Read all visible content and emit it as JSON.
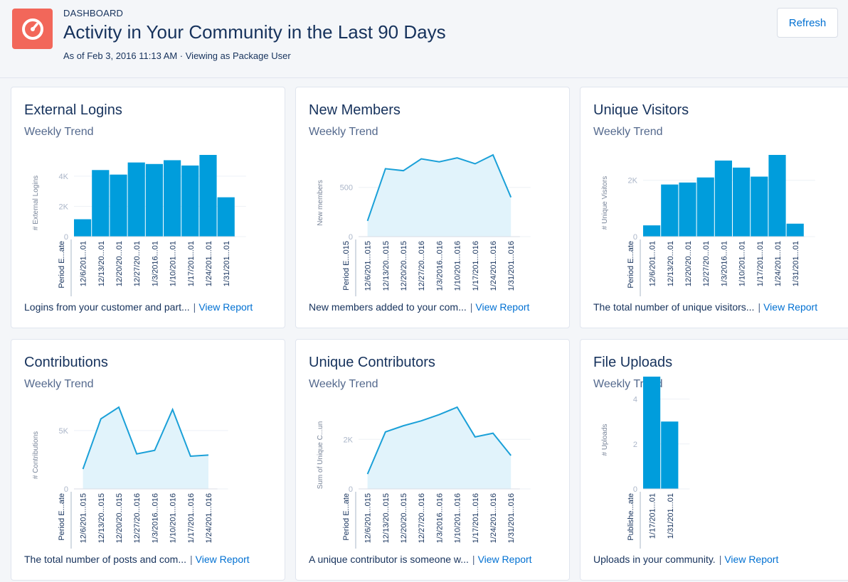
{
  "header": {
    "eyebrow": "DASHBOARD",
    "title": "Activity in Your Community in the Last 90 Days",
    "subtitle": "As of Feb 3, 2016 11:13 AM · Viewing as Package User",
    "refresh_label": "Refresh",
    "logo_icon": "dashboard-gauge-icon",
    "logo_color": "#f2675a"
  },
  "colors": {
    "bar": "#009ddc",
    "line": "#1aa0d8",
    "area": "#e1f3fb",
    "link": "#0070d2"
  },
  "view_report_label": "View Report",
  "cards": [
    {
      "title": "External Logins",
      "subtitle": "Weekly Trend",
      "footer": "Logins from your customer and part...",
      "footer_sep": "|"
    },
    {
      "title": "New Members",
      "subtitle": "Weekly Trend",
      "footer": "New members added to your com...",
      "footer_sep": "|"
    },
    {
      "title": "Unique Visitors",
      "subtitle": "Weekly Trend",
      "footer": "The total number of unique visitors...",
      "footer_sep": "|"
    },
    {
      "title": "Contributions",
      "subtitle": "Weekly Trend",
      "footer": "The total number of posts and com...",
      "footer_sep": "|"
    },
    {
      "title": "Unique Contributors",
      "subtitle": "Weekly Trend",
      "footer": "A unique contributor is someone w...",
      "footer_sep": "|"
    },
    {
      "title": "File Uploads",
      "subtitle": "Weekly Trend",
      "footer": "Uploads in your community.",
      "footer_sep": "|"
    }
  ],
  "chart_data": [
    {
      "type": "bar",
      "ylabel": "# External Logins",
      "xlabel": "Period E...ate",
      "categories": [
        "12/6/201...01",
        "12/13/20...01",
        "12/20/20...01",
        "12/27/20...01",
        "1/3/2016...01",
        "1/10/201...01",
        "1/17/201...01",
        "1/24/201...01",
        "1/31/201...01"
      ],
      "values": [
        1150,
        4400,
        4100,
        4900,
        4800,
        5050,
        4700,
        5400,
        2600
      ],
      "yticks": [
        0,
        2000,
        4000
      ],
      "ytick_labels": [
        "0",
        "2K",
        "4K"
      ],
      "ylim": [
        0,
        5400
      ]
    },
    {
      "type": "area",
      "ylabel": "New members",
      "xlabel": "Period E...015",
      "categories": [
        "12/6/201...015",
        "12/13/20...015",
        "12/20/20...015",
        "12/27/20...016",
        "1/3/2016...016",
        "1/10/201...016",
        "1/17/201...016",
        "1/24/201...016",
        "1/31/201...016"
      ],
      "values": [
        160,
        690,
        670,
        790,
        760,
        800,
        740,
        830,
        400
      ],
      "yticks": [
        0,
        500
      ],
      "ytick_labels": [
        "0",
        "500"
      ],
      "ylim": [
        0,
        830
      ]
    },
    {
      "type": "bar",
      "ylabel": "# Unique Visitors",
      "xlabel": "Period E...ate",
      "categories": [
        "12/6/201...01",
        "12/13/20...01",
        "12/20/20...01",
        "12/27/20...01",
        "1/3/2016...01",
        "1/10/201...01",
        "1/17/201...01",
        "1/24/201...01",
        "1/31/201...01"
      ],
      "values": [
        400,
        1850,
        1920,
        2100,
        2700,
        2450,
        2130,
        2900,
        460
      ],
      "yticks": [
        0,
        2000
      ],
      "ytick_labels": [
        "0",
        "2K"
      ],
      "ylim": [
        0,
        2900
      ]
    },
    {
      "type": "area",
      "ylabel": "# Contributions",
      "xlabel": "Period E...ate",
      "categories": [
        "12/6/201...015",
        "12/13/20...015",
        "12/20/20...015",
        "12/27/20...016",
        "1/3/2016...016",
        "1/10/201...016",
        "1/17/201...016",
        "1/24/201...016"
      ],
      "values": [
        1700,
        6000,
        7000,
        3000,
        3300,
        6800,
        2800,
        2900
      ],
      "yticks": [
        0,
        5000
      ],
      "ytick_labels": [
        "0",
        "5K"
      ],
      "ylim": [
        0,
        7000
      ]
    },
    {
      "type": "area",
      "ylabel": "Sum of Unique C...un",
      "xlabel": "Period E...ate",
      "categories": [
        "12/6/201...015",
        "12/13/20...015",
        "12/20/20...015",
        "12/27/20...016",
        "1/3/2016...016",
        "1/10/201...016",
        "1/17/201...016",
        "1/24/201...016",
        "1/31/201...016"
      ],
      "values": [
        600,
        2300,
        2550,
        2750,
        3000,
        3300,
        2100,
        2250,
        1350
      ],
      "yticks": [
        0,
        2000
      ],
      "ytick_labels": [
        "0",
        "2K"
      ],
      "ylim": [
        0,
        3300
      ]
    },
    {
      "type": "bar",
      "ylabel": "# Uploads",
      "xlabel": "Publishe...ate",
      "categories": [
        "1/17/201...01",
        "1/31/201...01"
      ],
      "values": [
        5,
        3
      ],
      "yticks": [
        0,
        2,
        4
      ],
      "ytick_labels": [
        "0",
        "2",
        "4"
      ],
      "ylim": [
        0,
        5
      ]
    }
  ]
}
